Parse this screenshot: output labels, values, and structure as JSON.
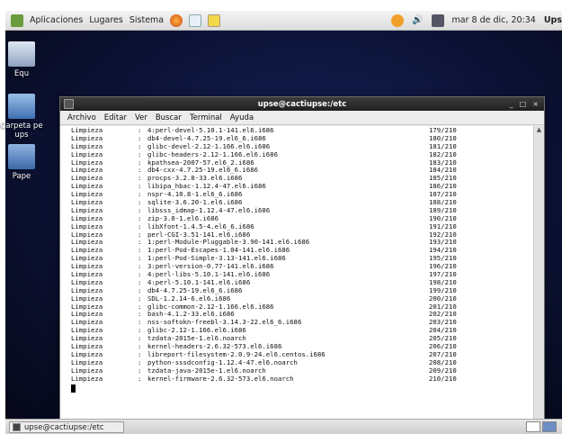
{
  "top_panel": {
    "menus": [
      "Aplicaciones",
      "Lugares",
      "Sistema"
    ],
    "clock": "mar 8 de dic, 20:34",
    "user": "Ups"
  },
  "desktop": {
    "icons": [
      {
        "label": "Equ"
      },
      {
        "label": "Carpeta pe\nups"
      },
      {
        "label": "Pape"
      }
    ]
  },
  "terminal": {
    "title": "upse@cactiupse:/etc",
    "window_controls": [
      "_",
      "□",
      "×"
    ],
    "menu": [
      "Archivo",
      "Editar",
      "Ver",
      "Buscar",
      "Terminal",
      "Ayuda"
    ],
    "rows": [
      {
        "action": "Limpieza",
        "package": "4:perl-devel-5.10.1-141.el6.i686",
        "count": "179/210"
      },
      {
        "action": "Limpieza",
        "package": "db4-devel-4.7.25-19.el6_6.i686",
        "count": "180/210"
      },
      {
        "action": "Limpieza",
        "package": "glibc-devel-2.12-1.166.el6.i686",
        "count": "181/210"
      },
      {
        "action": "Limpieza",
        "package": "glibc-headers-2.12-1.166.el6.i686",
        "count": "182/210"
      },
      {
        "action": "Limpieza",
        "package": "kpathsea-2007-57.el6_2.i686",
        "count": "183/210"
      },
      {
        "action": "Limpieza",
        "package": "db4-cxx-4.7.25-19.el6_6.i686",
        "count": "184/210"
      },
      {
        "action": "Limpieza",
        "package": "procps-3.2.8-33.el6.i686",
        "count": "185/210"
      },
      {
        "action": "Limpieza",
        "package": "libipa_hbac-1.12.4-47.el6.i686",
        "count": "186/210"
      },
      {
        "action": "Limpieza",
        "package": "nspr-4.10.8-1.el6_6.i686",
        "count": "187/210"
      },
      {
        "action": "Limpieza",
        "package": "sqlite-3.6.20-1.el6.i686",
        "count": "188/210"
      },
      {
        "action": "Limpieza",
        "package": "libsss_idmap-1.12.4-47.el6.i686",
        "count": "189/210"
      },
      {
        "action": "Limpieza",
        "package": "zip-3.0-1.el6.i686",
        "count": "190/210"
      },
      {
        "action": "Limpieza",
        "package": "libXfont-1.4.5-4.el6_6.i686",
        "count": "191/210"
      },
      {
        "action": "Limpieza",
        "package": "perl-CGI-3.51-141.el6.i686",
        "count": "192/210"
      },
      {
        "action": "Limpieza",
        "package": "1:perl-Module-Pluggable-3.90-141.el6.i686",
        "count": "193/210"
      },
      {
        "action": "Limpieza",
        "package": "1:perl-Pod-Escapes-1.04-141.el6.i686",
        "count": "194/210"
      },
      {
        "action": "Limpieza",
        "package": "1:perl-Pod-Simple-3.13-141.el6.i686",
        "count": "195/210"
      },
      {
        "action": "Limpieza",
        "package": "3:perl-version-0.77-141.el6.i686",
        "count": "196/210"
      },
      {
        "action": "Limpieza",
        "package": "4:perl-libs-5.10.1-141.el6.i686",
        "count": "197/210"
      },
      {
        "action": "Limpieza",
        "package": "4:perl-5.10.1-141.el6.i686",
        "count": "198/210"
      },
      {
        "action": "Limpieza",
        "package": "db4-4.7.25-19.el6_6.i686",
        "count": "199/210"
      },
      {
        "action": "Limpieza",
        "package": "SDL-1.2.14-6.el6.i686",
        "count": "200/210"
      },
      {
        "action": "Limpieza",
        "package": "glibc-common-2.12-1.166.el6.i686",
        "count": "201/210"
      },
      {
        "action": "Limpieza",
        "package": "bash-4.1.2-33.el6.i686",
        "count": "202/210"
      },
      {
        "action": "Limpieza",
        "package": "nss-softokn-freebl-3.14.3-22.el6_6.i686",
        "count": "203/210"
      },
      {
        "action": "Limpieza",
        "package": "glibc-2.12-1.166.el6.i686",
        "count": "204/210"
      },
      {
        "action": "Limpieza",
        "package": "tzdata-2015e-1.el6.noarch",
        "count": "205/210"
      },
      {
        "action": "Limpieza",
        "package": "kernel-headers-2.6.32-573.el6.i686",
        "count": "206/210"
      },
      {
        "action": "Limpieza",
        "package": "libreport-filesystem-2.0.9-24.el6.centos.i686",
        "count": "207/210"
      },
      {
        "action": "Limpieza",
        "package": "python-sssdconfig-1.12.4-47.el6.noarch",
        "count": "208/210"
      },
      {
        "action": "Limpieza",
        "package": "tzdata-java-2015e-1.el6.noarch",
        "count": "209/210"
      },
      {
        "action": "Limpieza",
        "package": "kernel-firmware-2.6.32-573.el6.noarch",
        "count": "210/210"
      }
    ]
  },
  "taskbar": {
    "task_label": "upse@cactiupse:/etc"
  }
}
